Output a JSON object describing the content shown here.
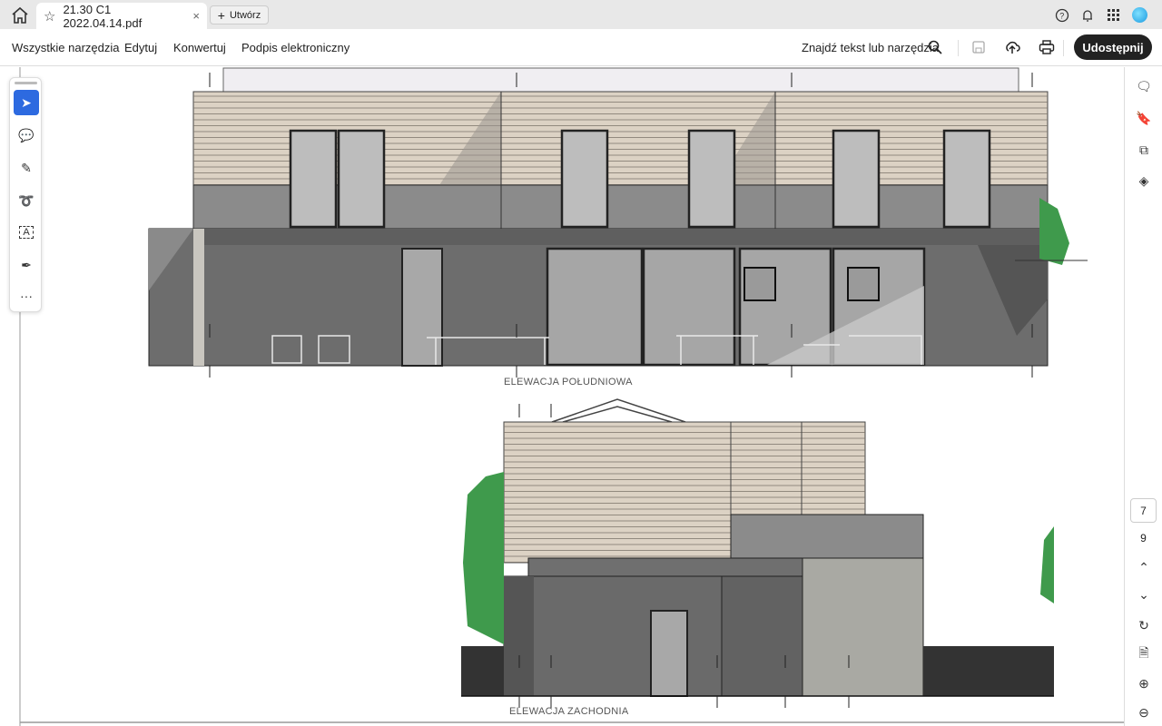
{
  "tabbar": {
    "filename": "21.30 C1 2022.04.14.pdf",
    "new_tab_label": "Utwórz",
    "close": "×",
    "plus": "+"
  },
  "menu": {
    "items": [
      "Wszystkie narzędzia",
      "Edytuj",
      "Konwertuj",
      "Podpis elektroniczny"
    ],
    "find": "Znajdź tekst lub narzędzia",
    "share": "Udostępnij"
  },
  "tools": {
    "more": "···"
  },
  "drawing": {
    "label_south": "ELEWACJA POŁUDNIOWA",
    "label_west": "ELEWACJA ZACHODNIA"
  },
  "navigation": {
    "current_page": "7",
    "total_pages": "9"
  },
  "colors": {
    "accent": "#2d6ae0",
    "share_bg": "#222222",
    "wood": "#d9cfc0",
    "gray": "#8a8a8a",
    "dark": "#6b6b6b",
    "tree": "#3f9a4c"
  }
}
